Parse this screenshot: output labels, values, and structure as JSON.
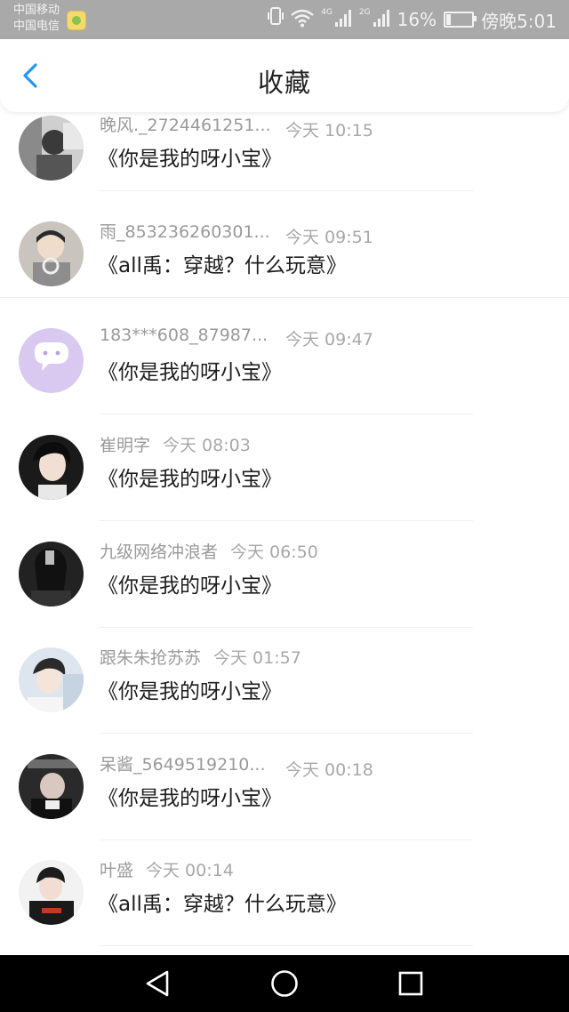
{
  "status_bar": {
    "carrier1": "中国移动",
    "carrier2": "中国电信",
    "net1": "4G",
    "net2": "2G",
    "battery_text": "16%",
    "battery_level": 0.16,
    "time": "傍晚5:01",
    "icons": [
      "vibrate-icon",
      "wifi-icon",
      "signal-icon",
      "battery-icon"
    ]
  },
  "header": {
    "title": "收藏",
    "back_icon": "chevron-left-icon",
    "accent": "#2196f3"
  },
  "items": [
    {
      "username": "晚风._2724461251...",
      "time": "今天 10:15",
      "title": "《你是我的呀小宝》"
    },
    {
      "username": "雨_853236260301...",
      "time": "今天 09:51",
      "title": "《all禹：穿越？什么玩意》"
    },
    {
      "username": "183***608_87987...",
      "time": "今天 09:47",
      "title": "《你是我的呀小宝》"
    },
    {
      "username": "崔明字",
      "time": "今天 08:03",
      "title": "《你是我的呀小宝》"
    },
    {
      "username": "九级网络冲浪者",
      "time": "今天 06:50",
      "title": "《你是我的呀小宝》"
    },
    {
      "username": "跟朱朱抢苏苏",
      "time": "今天 01:57",
      "title": "《你是我的呀小宝》"
    },
    {
      "username": "呆酱_5649519210...",
      "time": "今天 00:18",
      "title": "《你是我的呀小宝》"
    },
    {
      "username": "叶盛",
      "time": "今天 00:14",
      "title": "《all禹：穿越？什么玩意》"
    }
  ],
  "nav": {
    "back_icon": "triangle-back-icon",
    "home_icon": "circle-home-icon",
    "recents_icon": "square-recents-icon"
  }
}
